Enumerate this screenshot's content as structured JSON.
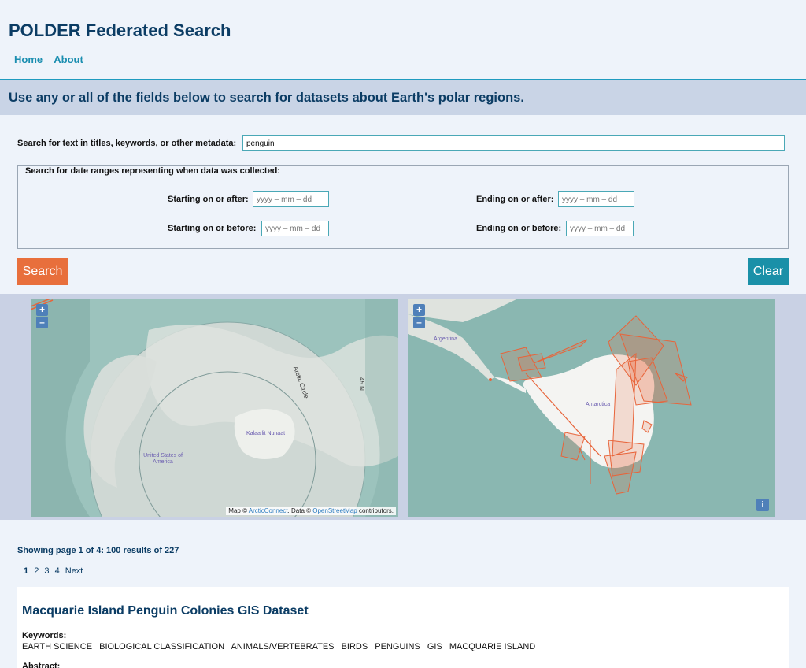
{
  "header": {
    "title": "POLDER Federated Search",
    "nav": [
      "Home",
      "About"
    ]
  },
  "banner": "Use any or all of the fields below to search for datasets about Earth's polar regions.",
  "search": {
    "text_label": "Search for text in titles, keywords, or other metadata:",
    "text_value": "penguin",
    "date_legend": "Search for date ranges representing when data was collected:",
    "start_after_label": "Starting on or after:",
    "start_before_label": "Starting on or before:",
    "end_after_label": "Ending on or after:",
    "end_before_label": "Ending on or before:",
    "date_placeholder": "yyyy – mm – dd",
    "search_button": "Search",
    "clear_button": "Clear"
  },
  "maps": {
    "zoom_in": "+",
    "zoom_out": "–",
    "attribution": {
      "prefix": "Map ©",
      "arctic_link": "ArcticConnect",
      "middle": ". Data ©",
      "osm_link": "OpenStreetMap",
      "suffix": "contributors."
    },
    "left_labels": {
      "arctic_circle": "Arctic Circle",
      "meridian": "45 N",
      "greenland": "Kalaallit Nunaat",
      "usa": "United States of America"
    },
    "right_labels": {
      "argentina": "Argentina",
      "antarctica": "Antarctica"
    },
    "info": "i"
  },
  "results": {
    "summary": "Showing page 1 of 4: 100 results of 227",
    "pages": [
      "1",
      "2",
      "3",
      "4",
      "Next"
    ],
    "items": [
      {
        "title": "Macquarie Island Penguin Colonies GIS Dataset",
        "keywords_label": "Keywords:",
        "keywords": [
          "EARTH SCIENCE",
          "BIOLOGICAL CLASSIFICATION",
          "ANIMALS/VERTEBRATES",
          "BIRDS",
          "PENGUINS",
          "GIS",
          "MACQUARIE ISLAND"
        ],
        "abstract_label": "Abstract:"
      }
    ]
  },
  "colors": {
    "brand": "#0b3c64",
    "link": "#1a8eb0",
    "search_button": "#e86f3c",
    "clear_button": "#1a90a8",
    "polygon": "#e8643a"
  }
}
